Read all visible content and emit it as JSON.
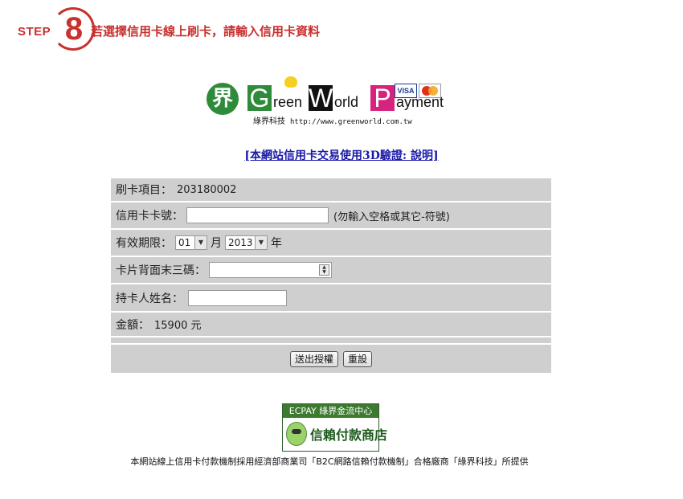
{
  "step": {
    "word": "STEP",
    "number": "8",
    "text": "若選擇信用卡線上刷卡，請輸入信用卡資料"
  },
  "logo": {
    "mark": "界",
    "g": "G",
    "reen": "reen",
    "w": "W",
    "orld": "orld",
    "p": "P",
    "ayment": "ayment",
    "visa": "VISA",
    "company": "綠界科技",
    "url": "http://www.greenworld.com.tw"
  },
  "link_3d": "[本網站信用卡交易使用3D驗證: 說明]",
  "form": {
    "item_label": "刷卡項目：",
    "item_value": "203180002",
    "card_label": "信用卡卡號：",
    "card_value": "",
    "card_hint": "(勿輸入空格或其它-符號)",
    "expiry_label": "有效期限：",
    "month": "01",
    "month_unit": "月",
    "year": "2013",
    "year_unit": "年",
    "cvv_label": "卡片背面末三碼：",
    "cvv_value": "",
    "name_label": "持卡人姓名：",
    "name_value": "",
    "amount_label": "金額：",
    "amount_value": "15900 元",
    "submit": "送出授權",
    "reset": "重設"
  },
  "ecpay": {
    "top": "ECPAY 綠界金流中心",
    "text": "信賴付款商店"
  },
  "footer": "本網站線上信用卡付款機制採用經濟部商業司「B2C網路信賴付款機制」合格廠商「綠界科技」所提供",
  "colors": {
    "accent": "#c8312f",
    "form_bg": "#cfcfcf",
    "brand_green": "#2e8b3a",
    "link": "#1a1aa8"
  }
}
